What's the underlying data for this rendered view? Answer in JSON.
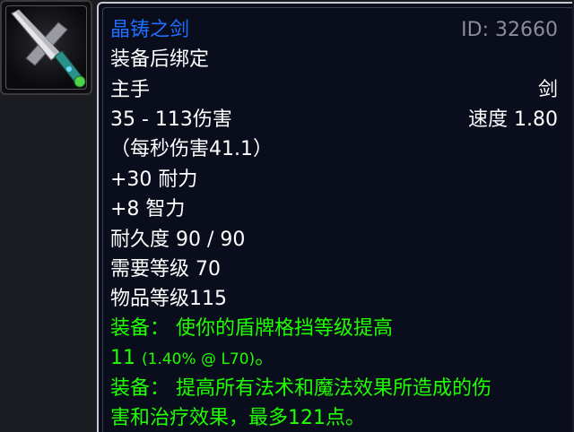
{
  "item": {
    "name": "晶铸之剑",
    "id_text": "ID: 32660",
    "binding": "装备后绑定",
    "slot": "主手",
    "type": "剑",
    "damage": "35 - 113伤害",
    "speed": "速度 1.80",
    "dps": "（每秒伤害41.1）",
    "stat_stamina": "+30 耐力",
    "stat_intellect": "+8 智力",
    "durability": "耐久度 90 / 90",
    "required_level": "需要等级 70",
    "item_level": "物品等级115",
    "equip1_line1": "装备： 使你的盾牌格挡等级提高",
    "equip1_value": "11",
    "equip1_detail": "(1.40% @ L70)",
    "equip1_end": "。",
    "equip2_line1": "装备： 提高所有法术和魔法效果所造成的伤",
    "equip2_line2": "害和治疗效果，最多121点。"
  },
  "colors": {
    "name_rare_blue": "#1e6fff",
    "equip_green": "#1eff00",
    "id_gray": "#8c8c96",
    "text_white": "#ffffff",
    "tooltip_bg": "#0a0d1c"
  },
  "icon": {
    "name": "sword-icon"
  }
}
